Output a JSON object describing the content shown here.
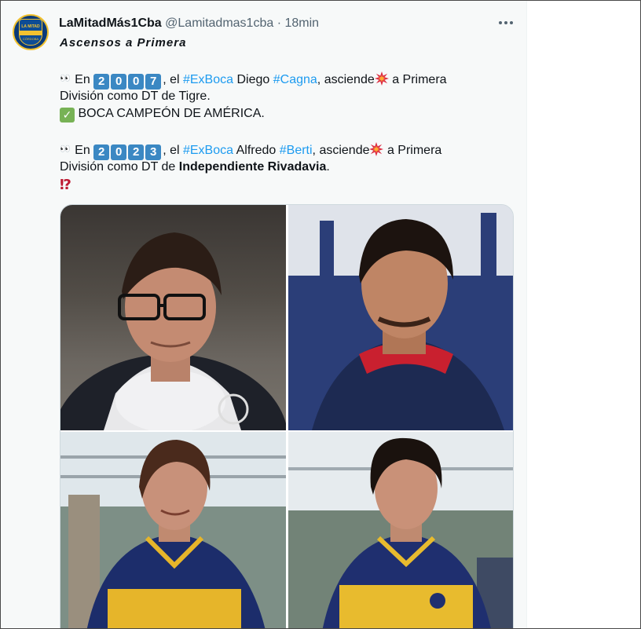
{
  "tweet": {
    "display_name": "LaMitadMás1Cba",
    "handle": "@Lamitadmas1cba",
    "separator": "·",
    "time": "18min",
    "subtitle": "Ascensos a Primera",
    "line1": {
      "eyes": "👀",
      "prefix": "En",
      "year_digits": [
        "2",
        "0",
        "0",
        "7"
      ],
      "sep1": ", el",
      "tag1": "#ExBoca",
      "mid": "Diego",
      "tag2": "#Cagna",
      "after": ", asciende",
      "end": "a Primera"
    },
    "line2": "División como DT de Tigre.",
    "line3": {
      "check": "✓",
      "text": "BOCA CAMPEÓN DE AMÉRICA."
    },
    "line4": {
      "eyes": "👀",
      "prefix": "En",
      "year_digits": [
        "2",
        "0",
        "2",
        "3"
      ],
      "sep1": ", el",
      "tag1": "#ExBoca",
      "mid": "Alfredo",
      "tag2": "#Berti",
      "after": ", asciende",
      "end": "a Primera"
    },
    "line5": {
      "prefix": "División como DT de",
      "bold": "Independiente Rivadavia",
      "suffix": "."
    },
    "line6": "⁉"
  },
  "avatar": {
    "top_text": "LA MITAD",
    "bottom_text": "CÓRDOBA"
  },
  "colors": {
    "link": "#1d9bf0",
    "text": "#0f1419",
    "muted": "#536471",
    "keycap": "#3b88c3",
    "check": "#77b255",
    "alert": "#be1931"
  },
  "icons": {
    "more": "more-horizontal-icon",
    "collision": "collision-emoji-icon"
  }
}
